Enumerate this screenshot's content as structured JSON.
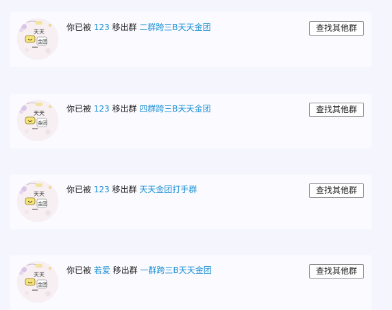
{
  "notices": [
    {
      "prefix": "你已被",
      "operator": "123",
      "action": "移出群",
      "group": "二群跨三B天天金团",
      "button_label": "查找其他群"
    },
    {
      "prefix": "你已被",
      "operator": "123",
      "action": "移出群",
      "group": "四群跨三B天天金团",
      "button_label": "查找其他群"
    },
    {
      "prefix": "你已被",
      "operator": "123",
      "action": "移出群",
      "group": "天天金团打手群",
      "button_label": "查找其他群"
    },
    {
      "prefix": "你已被",
      "operator": "若爱",
      "action": "移出群",
      "group": "一群跨三B天天金团",
      "button_label": "查找其他群"
    }
  ],
  "avatar": {
    "text_top": "天天",
    "text_bottom": "金团"
  },
  "colors": {
    "background": "#f5f5fd",
    "card": "#fafaff",
    "link": "#1a8fd4",
    "text": "#222222"
  }
}
